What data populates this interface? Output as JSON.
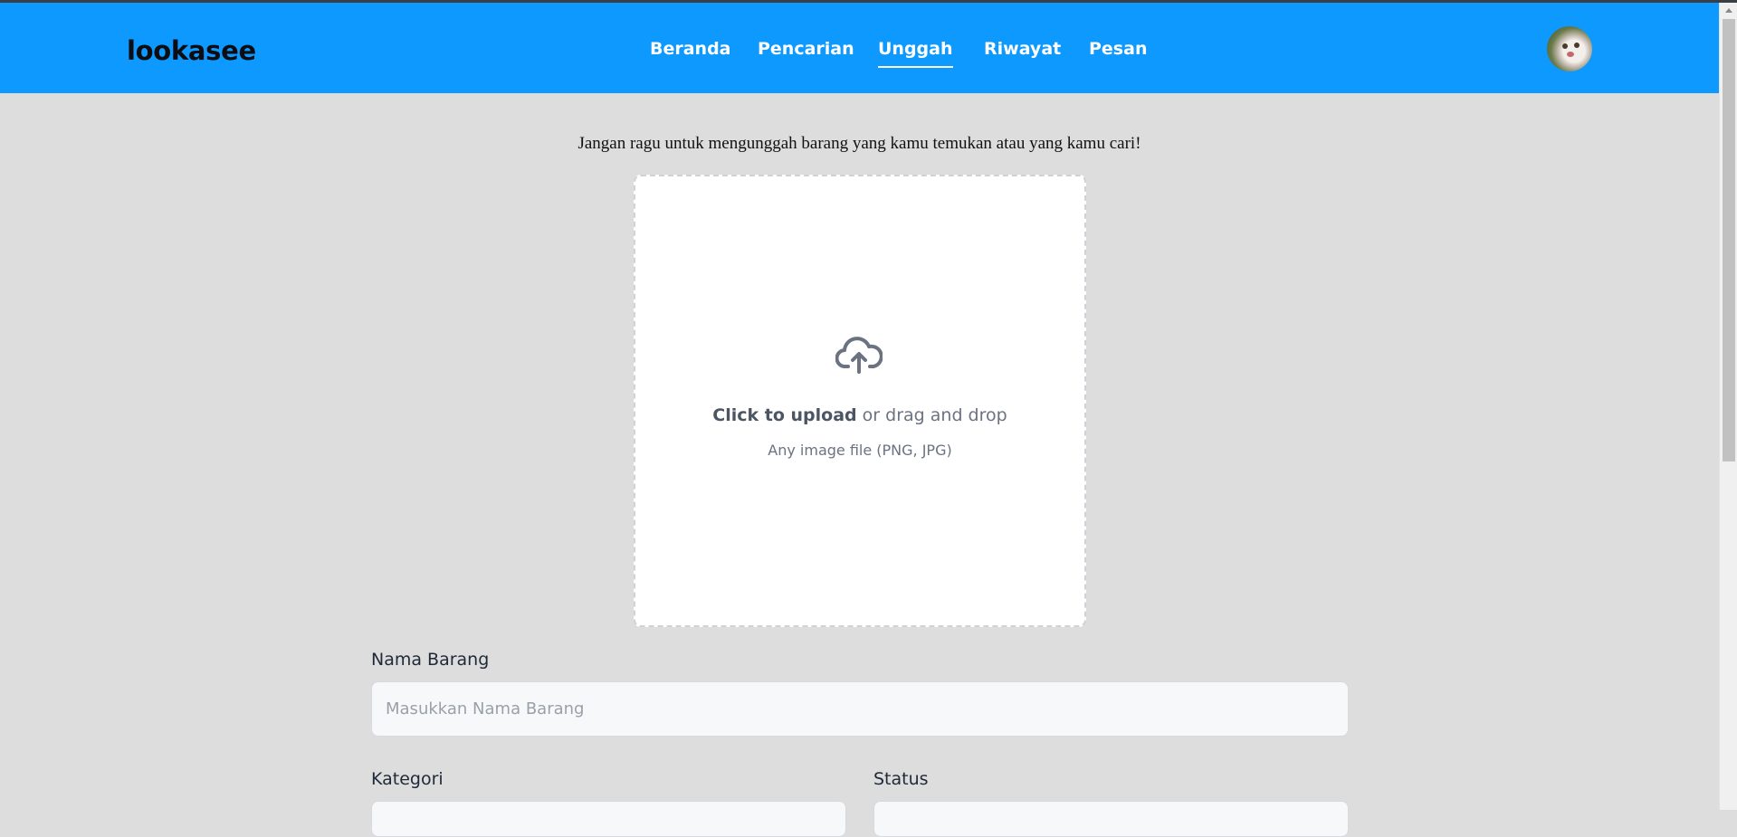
{
  "app": {
    "logo": "lookasee"
  },
  "nav": {
    "items": [
      {
        "label": "Beranda",
        "active": false
      },
      {
        "label": "Pencarian",
        "active": false
      },
      {
        "label": "Unggah",
        "active": true
      },
      {
        "label": "Riwayat",
        "active": false
      },
      {
        "label": "Pesan",
        "active": false
      }
    ]
  },
  "page": {
    "intro": "Jangan ragu untuk mengunggah barang yang kamu temukan atau yang kamu cari!"
  },
  "upload": {
    "icon": "cloud-upload-icon",
    "click_label": "Click to upload",
    "drag_label": " or drag and drop",
    "hint": "Any image file (PNG, JPG)"
  },
  "form": {
    "name": {
      "label": "Nama Barang",
      "placeholder": "Masukkan Nama Barang",
      "value": ""
    },
    "category": {
      "label": "Kategori"
    },
    "status": {
      "label": "Status"
    }
  },
  "colors": {
    "navbar": "#0e99ff",
    "background": "#dddddd",
    "text_muted": "#6b7280"
  }
}
